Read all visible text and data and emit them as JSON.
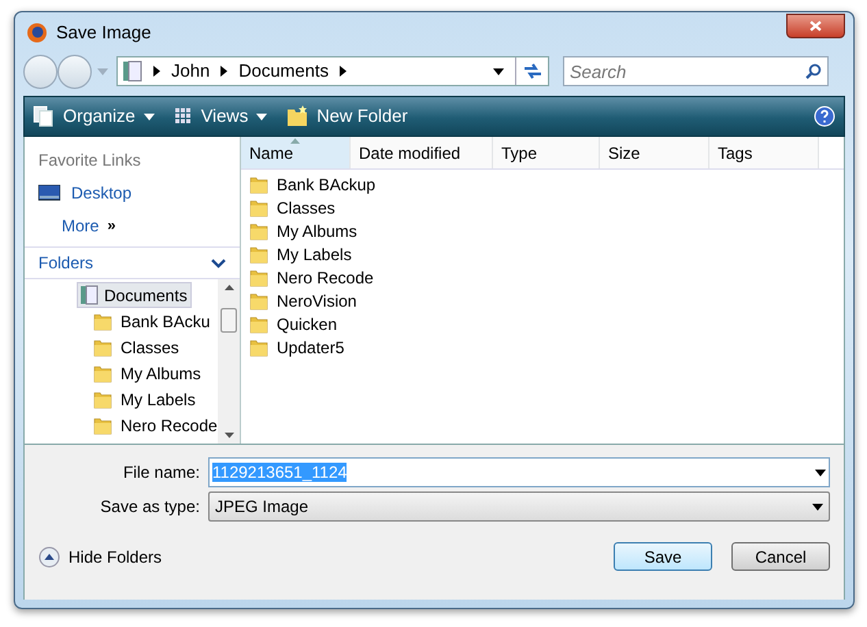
{
  "window": {
    "title": "Save Image"
  },
  "address_bar": {
    "segments": [
      "John",
      "Documents"
    ]
  },
  "search": {
    "placeholder": "Search"
  },
  "toolbar": {
    "items": [
      {
        "label": "Organize",
        "dropdown": true,
        "kind": "organize"
      },
      {
        "label": "Views",
        "dropdown": true,
        "kind": "views"
      },
      {
        "label": "New Folder",
        "dropdown": false,
        "kind": "new-folder"
      }
    ]
  },
  "favorite_links": {
    "title": "Favorite Links",
    "items": [
      {
        "label": "Desktop"
      }
    ],
    "more": "More",
    "more_glyph": "»"
  },
  "folders": {
    "title": "Folders",
    "tree": [
      {
        "label": "Documents",
        "selected": true,
        "children": [
          {
            "label": "Bank BAcku",
            "selected": false
          },
          {
            "label": "Classes",
            "selected": false
          },
          {
            "label": "My Albums",
            "selected": false
          },
          {
            "label": "My Labels",
            "selected": false
          },
          {
            "label": "Nero Recode",
            "selected": false
          }
        ]
      }
    ]
  },
  "file_list": {
    "columns": [
      {
        "label": "Name",
        "sorted": true
      },
      {
        "label": "Date modified",
        "sorted": false
      },
      {
        "label": "Type",
        "sorted": false
      },
      {
        "label": "Size",
        "sorted": false
      },
      {
        "label": "Tags",
        "sorted": false
      }
    ],
    "items": [
      "Bank BAckup",
      "Classes",
      "My Albums",
      "My Labels",
      "Nero Recode",
      "NeroVision",
      "Quicken",
      "Updater5"
    ]
  },
  "file_name": {
    "label": "File name:",
    "value": "1129213651_1124",
    "selected": true
  },
  "save_as_type": {
    "label": "Save as type:",
    "value": "JPEG Image"
  },
  "hide_folders": "Hide Folders",
  "buttons": [
    {
      "label": "Save",
      "default": true
    },
    {
      "label": "Cancel",
      "default": false
    }
  ]
}
